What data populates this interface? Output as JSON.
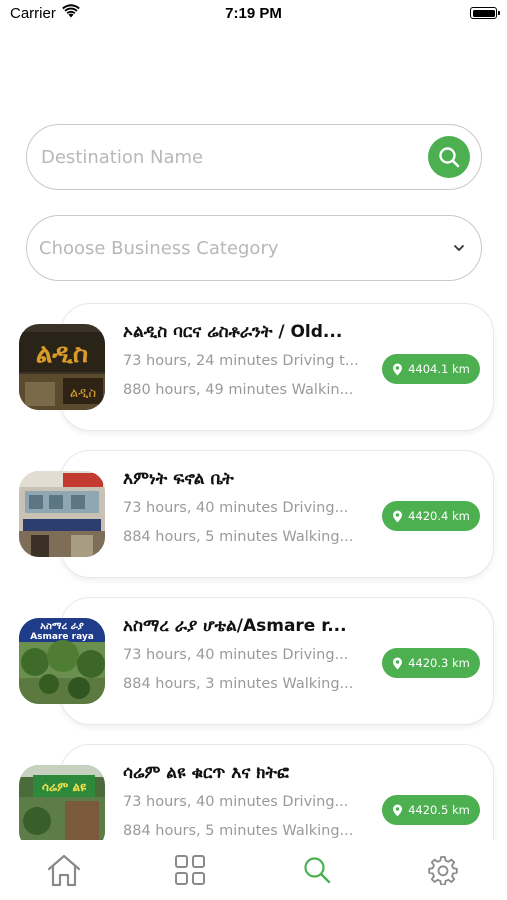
{
  "status_bar": {
    "carrier": "Carrier",
    "time": "7:19 PM",
    "icons": [
      "wifi-icon",
      "battery-icon"
    ]
  },
  "search": {
    "placeholder": "Destination Name",
    "button_icon": "search-icon"
  },
  "category": {
    "placeholder": "Choose Business Category",
    "icon": "chevron-down-icon"
  },
  "colors": {
    "accent": "#4caf50",
    "border": "#c9c9c9",
    "secondary_text": "#9a9a9a",
    "tab_inactive": "#8a8a8a"
  },
  "places": [
    {
      "name": "ኦልዲስ ባርና ሬስቶራንት / Old...",
      "driving": "73 hours, 24 minutes  Driving t...",
      "walking": "880 hours, 49 minutes  Walkin...",
      "distance": "4404.1 km",
      "badge_icon": "location-pin-icon"
    },
    {
      "name": "እምነት ፍኖል ቤት",
      "driving": "73 hours, 40 minutes  Driving...",
      "walking": "884 hours, 5 minutes  Walking...",
      "distance": "4420.4 km",
      "badge_icon": "location-pin-icon"
    },
    {
      "name": "አስማረ ራያ ሆቴል/Asmare r...",
      "driving": "73 hours, 40 minutes  Driving...",
      "walking": "884 hours, 3 minutes  Walking...",
      "distance": "4420.3 km",
      "badge_icon": "location-pin-icon"
    },
    {
      "name": "ሳሬም ልዩ ቁርጥ እና ክትፎ",
      "driving": "73 hours, 40 minutes  Driving...",
      "walking": "884 hours, 5 minutes  Walking...",
      "distance": "4420.5 km",
      "badge_icon": "location-pin-icon"
    }
  ],
  "tab_bar": {
    "tabs": [
      {
        "icon": "home-icon",
        "active": false
      },
      {
        "icon": "grid-icon",
        "active": false
      },
      {
        "icon": "search-icon",
        "active": true
      },
      {
        "icon": "gear-icon",
        "active": false
      }
    ]
  }
}
